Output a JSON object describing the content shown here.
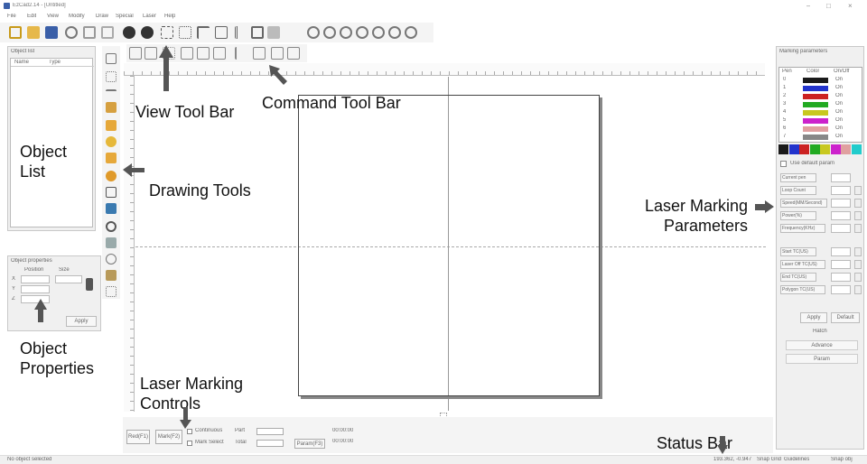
{
  "window": {
    "title": "EzCad2.14 - [Untitled]",
    "controls": [
      "–",
      "□",
      "×"
    ]
  },
  "menu": [
    "File",
    "Edit",
    "View",
    "Modify",
    "Draw",
    "Special",
    "Laser",
    "Help"
  ],
  "object_list": {
    "title": "Object list",
    "columns": [
      "Name",
      "Type"
    ]
  },
  "object_properties": {
    "title": "Object properties",
    "fields": [
      "Position",
      "Size"
    ],
    "axes": [
      "X",
      "Y",
      "Z"
    ],
    "apply_label": "Apply"
  },
  "marking_params": {
    "title": "Marking parameters",
    "columns": [
      "Pen",
      "Color",
      "On/Off"
    ],
    "pens": [
      {
        "name": "0",
        "color": "#1a1a1a",
        "state": "On"
      },
      {
        "name": "1",
        "color": "#2233cc",
        "state": "On"
      },
      {
        "name": "2",
        "color": "#cc2222",
        "state": "On"
      },
      {
        "name": "3",
        "color": "#22aa22",
        "state": "On"
      },
      {
        "name": "4",
        "color": "#c8c820",
        "state": "On"
      },
      {
        "name": "5",
        "color": "#cc22cc",
        "state": "On"
      },
      {
        "name": "6",
        "color": "#e0a0a0",
        "state": "On"
      },
      {
        "name": "7",
        "color": "#888888",
        "state": "On"
      }
    ],
    "palette": [
      "#1a1a1a",
      "#2233cc",
      "#cc2222",
      "#22aa22",
      "#c8c820",
      "#cc22cc",
      "#e0a0a0",
      "#22cccc"
    ],
    "use_default": "Use default param",
    "rows1": [
      "Current pen",
      "Loop Count",
      "Speed(MM/Second)",
      "Power(%)",
      "Frequency(KHz)"
    ],
    "rows2": [
      "Start TC(US)",
      "Laser Off TC(US)",
      "End TC(US)",
      "Polygon TC(US)"
    ],
    "buttons": [
      "Apply",
      "Default"
    ],
    "hatch_label": "Hatch",
    "advance_label": "Advance",
    "param_label": "Param"
  },
  "marking_controls": {
    "red_label": "Red(F1)",
    "mark_label": "Mark(F2)",
    "continuous_label": "Continuous",
    "part_label": "Part",
    "mark_select_label": "Mark Select",
    "total_label": "Total",
    "param_label": "Param(F3)",
    "time1": "00:00:00",
    "time2": "00:00:00"
  },
  "status": {
    "left": "No object selected",
    "right": [
      "193.362, -0.947",
      "Snap Grid",
      "Guidelines",
      "Snap obj"
    ]
  },
  "annotations": {
    "view_tool_bar": "View Tool Bar",
    "command_tool_bar": "Command Tool Bar",
    "object_list": "Object List",
    "drawing_tools": "Drawing Tools",
    "laser_marking_parameters": "Laser Marking Parameters",
    "object_properties": "Object Properties",
    "laser_marking_controls": "Laser Marking Controls",
    "status_bar": "Status Bar"
  },
  "ann_lines": {
    "object_list": [
      "Object",
      "List"
    ],
    "laser_params": [
      "Laser Marking",
      "Parameters"
    ],
    "object_props": [
      "Object",
      "Properties"
    ],
    "laser_controls": [
      "Laser Marking",
      "Controls"
    ]
  },
  "icons": {
    "toolbar_main": [
      "new-icon",
      "open-icon",
      "save-icon",
      "cut-icon",
      "copy-icon",
      "paste-icon",
      "undo-icon",
      "redo-icon",
      "grid-icon",
      "snap-icon",
      "guide-icon",
      "obj-snap-icon",
      "zoom-icon"
    ],
    "drawing": [
      "select-icon",
      "node-icon",
      "line-icon",
      "hand-icon",
      "rect-icon",
      "circle-icon",
      "polygon-icon",
      "curve-icon",
      "text-icon",
      "image-icon",
      "barcode-icon",
      "delay-icon",
      "io-icon",
      "timer-icon",
      "encoder-icon"
    ]
  },
  "colors": {
    "accent": "#3366cc",
    "canvas_border": "#444444",
    "toolbar_bg": "#f0f0f0"
  }
}
